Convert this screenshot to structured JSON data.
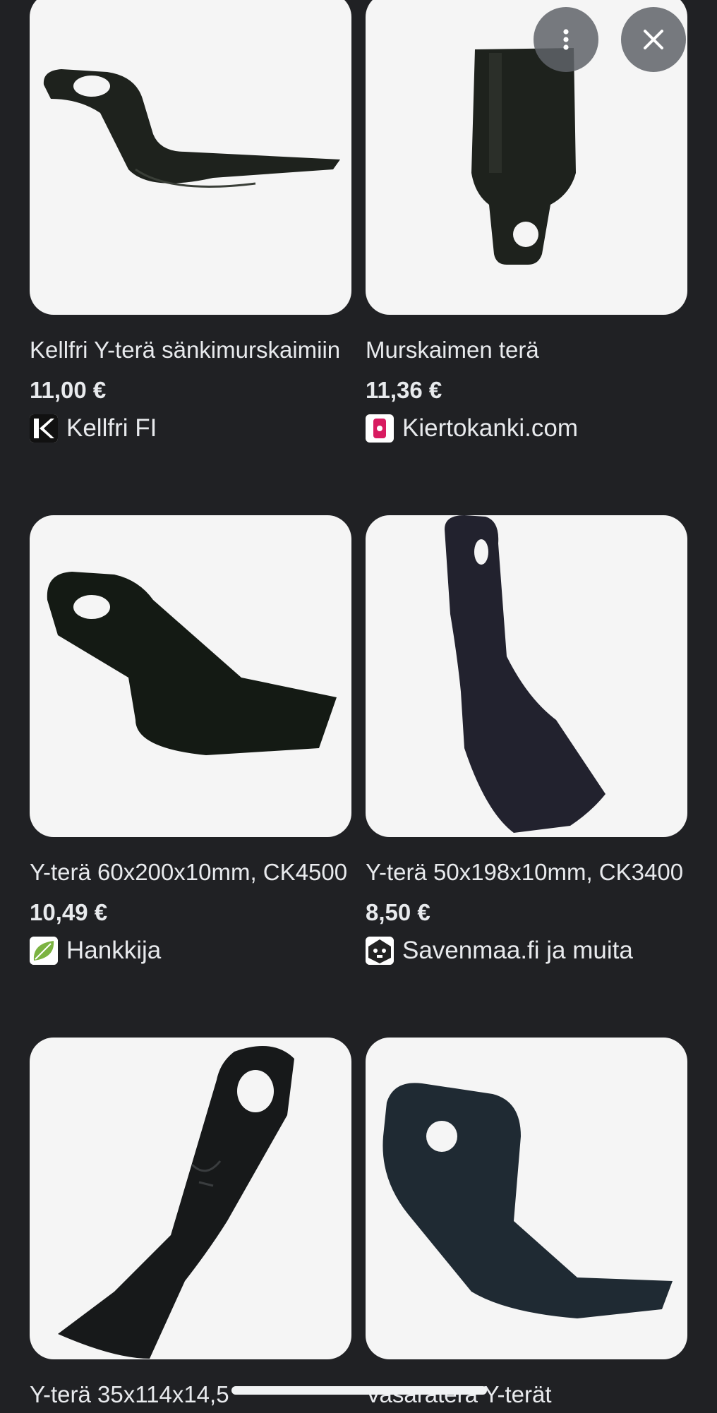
{
  "results": [
    {
      "title": "Kellfri Y-terä sänkimurskaimiin",
      "price": "11,00 €",
      "source": "Kellfri FI",
      "favicon": "kellfri-k-icon"
    },
    {
      "title": "Murskaimen terä",
      "price": "11,36 €",
      "source": "Kiertokanki.com",
      "favicon": "kiertokanki-icon"
    },
    {
      "title": "Y-terä 60x200x10mm, CK4500",
      "price": "10,49 €",
      "source": "Hankkija",
      "favicon": "hankkija-leaf-icon"
    },
    {
      "title": "Y-terä 50x198x10mm, CK3400",
      "price": "8,50 €",
      "source": "Savenmaa.fi ja muita",
      "favicon": "savenmaa-icon"
    },
    {
      "title": "Y-terä 35x114x14,5",
      "price": "",
      "source": "",
      "favicon": ""
    },
    {
      "title": "Vasaraterä Y-terät",
      "price": "",
      "source": "",
      "favicon": ""
    }
  ],
  "overlay": {
    "more_icon": "more-vert-icon",
    "close_icon": "close-icon"
  },
  "colors": {
    "background": "#202124",
    "thumb_bg": "#f5f5f5",
    "text": "#e8eaed",
    "kiertokanki": "#d81b60",
    "hankkija": "#7cb342"
  }
}
